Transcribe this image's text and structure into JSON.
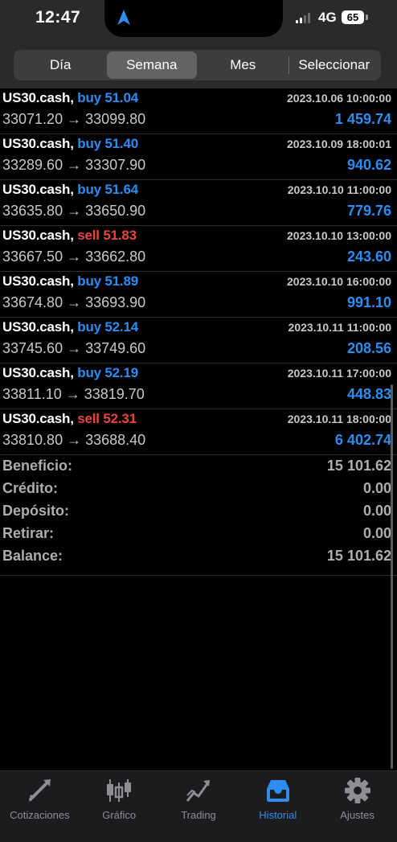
{
  "status_bar": {
    "time": "12:47",
    "network": "4G",
    "battery": "65"
  },
  "periods": [
    {
      "label": "Día",
      "active": false
    },
    {
      "label": "Semana",
      "active": true
    },
    {
      "label": "Mes",
      "active": false
    },
    {
      "label": "Seleccionar",
      "active": false
    }
  ],
  "trades": [
    {
      "symbol": "US30.cash,",
      "direction": "buy",
      "volume": "buy 51.04",
      "time": "2023.10.06 10:00:00",
      "prices": "33071.20 → 33099.80",
      "profit": "1 459.74"
    },
    {
      "symbol": "US30.cash,",
      "direction": "buy",
      "volume": "buy 51.40",
      "time": "2023.10.09 18:00:01",
      "prices": "33289.60 → 33307.90",
      "profit": "940.62"
    },
    {
      "symbol": "US30.cash,",
      "direction": "buy",
      "volume": "buy 51.64",
      "time": "2023.10.10 11:00:00",
      "prices": "33635.80 → 33650.90",
      "profit": "779.76"
    },
    {
      "symbol": "US30.cash,",
      "direction": "sell",
      "volume": "sell 51.83",
      "time": "2023.10.10 13:00:00",
      "prices": "33667.50 → 33662.80",
      "profit": "243.60"
    },
    {
      "symbol": "US30.cash,",
      "direction": "buy",
      "volume": "buy 51.89",
      "time": "2023.10.10 16:00:00",
      "prices": "33674.80 → 33693.90",
      "profit": "991.10"
    },
    {
      "symbol": "US30.cash,",
      "direction": "buy",
      "volume": "buy 52.14",
      "time": "2023.10.11 11:00:00",
      "prices": "33745.60 → 33749.60",
      "profit": "208.56"
    },
    {
      "symbol": "US30.cash,",
      "direction": "buy",
      "volume": "buy 52.19",
      "time": "2023.10.11 17:00:00",
      "prices": "33811.10 → 33819.70",
      "profit": "448.83"
    },
    {
      "symbol": "US30.cash,",
      "direction": "sell",
      "volume": "sell 52.31",
      "time": "2023.10.11 18:00:00",
      "prices": "33810.80 → 33688.40",
      "profit": "6 402.74"
    }
  ],
  "summary": [
    {
      "label": "Beneficio:",
      "value": "15 101.62"
    },
    {
      "label": "Crédito:",
      "value": "0.00"
    },
    {
      "label": "Depósito:",
      "value": "0.00"
    },
    {
      "label": "Retirar:",
      "value": "0.00"
    },
    {
      "label": "Balance:",
      "value": "15 101.62"
    }
  ],
  "tabs": [
    {
      "label": "Cotizaciones",
      "icon": "quotes-icon",
      "active": false
    },
    {
      "label": "Gráfico",
      "icon": "chart-icon",
      "active": false
    },
    {
      "label": "Trading",
      "icon": "trading-icon",
      "active": false
    },
    {
      "label": "Historial",
      "icon": "history-icon",
      "active": true
    },
    {
      "label": "Ajustes",
      "icon": "settings-icon",
      "active": false
    }
  ],
  "colors": {
    "buy": "#2d8cf0",
    "sell": "#e8453c",
    "profit": "#2d8cf0",
    "active_tab": "#2d8cf0"
  }
}
